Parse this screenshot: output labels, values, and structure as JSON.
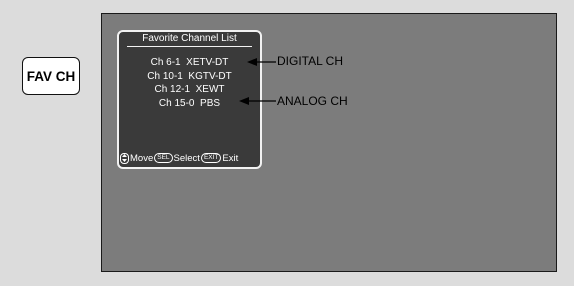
{
  "remote": {
    "fav_ch_label": "FAV CH"
  },
  "osd": {
    "title": "Favorite Channel List",
    "channels": [
      "Ch 6-1  XETV-DT",
      "Ch 10-1  KGTV-DT",
      "Ch 12-1  XEWT",
      "Ch 15-0  PBS"
    ],
    "footer": {
      "move_label": "Move",
      "sel_key": "SEL",
      "select_label": "Select",
      "exit_key": "EXIT",
      "exit_label": "Exit"
    }
  },
  "callouts": {
    "digital": "DIGITAL CH",
    "analog": "ANALOG CH"
  },
  "colors": {
    "screen": "#7c7c7c",
    "osd_panel": "#3a3a3a",
    "background": "#dcdcdc"
  }
}
